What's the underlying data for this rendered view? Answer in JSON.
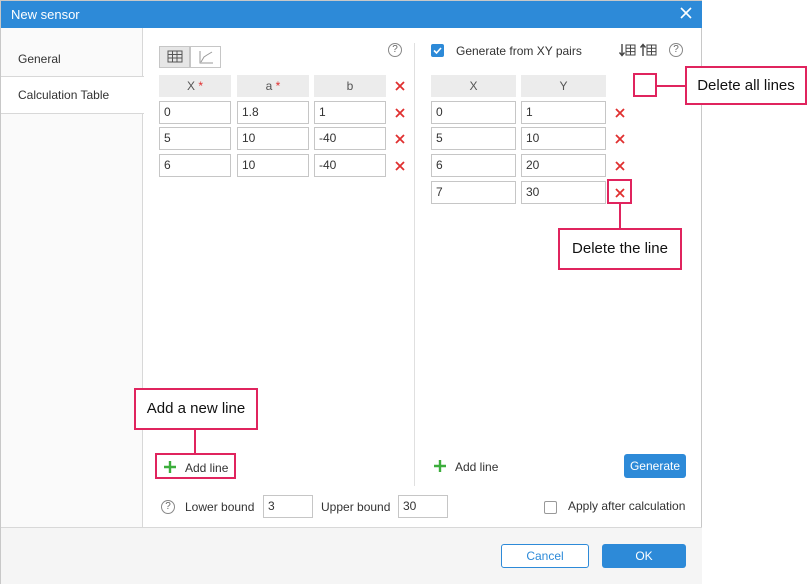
{
  "dialog": {
    "title": "New sensor",
    "close_icon": "close-icon"
  },
  "tabs": [
    {
      "label": "General",
      "active": false
    },
    {
      "label": "Calculation Table",
      "active": true
    }
  ],
  "left_table": {
    "headers": [
      {
        "label": "X",
        "required": true
      },
      {
        "label": "a",
        "required": true
      },
      {
        "label": "b",
        "required": false
      }
    ],
    "rows": [
      [
        "0",
        "1.8",
        "1"
      ],
      [
        "5",
        "10",
        "-40"
      ],
      [
        "6",
        "10",
        "-40"
      ]
    ],
    "view_buttons": [
      "table-icon",
      "chart-icon"
    ],
    "add_line_label": "Add line"
  },
  "right_table": {
    "generate_checkbox_label": "Generate from XY pairs",
    "generate_checked": true,
    "headers": [
      "X",
      "Y"
    ],
    "rows": [
      [
        "0",
        "1"
      ],
      [
        "5",
        "10"
      ],
      [
        "6",
        "20"
      ],
      [
        "7",
        "30"
      ]
    ],
    "add_line_label": "Add line",
    "generate_button": "Generate",
    "tool_icons": [
      "sort-descending-icon",
      "sort-ascending-icon"
    ]
  },
  "bounds": {
    "lower_label": "Lower bound",
    "lower_value": "3",
    "upper_label": "Upper bound",
    "upper_value": "30",
    "apply_after_label": "Apply after calculation",
    "apply_after_checked": false
  },
  "footer": {
    "cancel_label": "Cancel",
    "ok_label": "OK"
  },
  "annotations": {
    "delete_all": "Delete all lines",
    "delete_line": "Delete the line",
    "add_line": "Add a new line"
  },
  "colors": {
    "accent": "#2d8ad8",
    "delete": "#e03030",
    "add": "#3cae3c",
    "callout": "#e0245e"
  }
}
